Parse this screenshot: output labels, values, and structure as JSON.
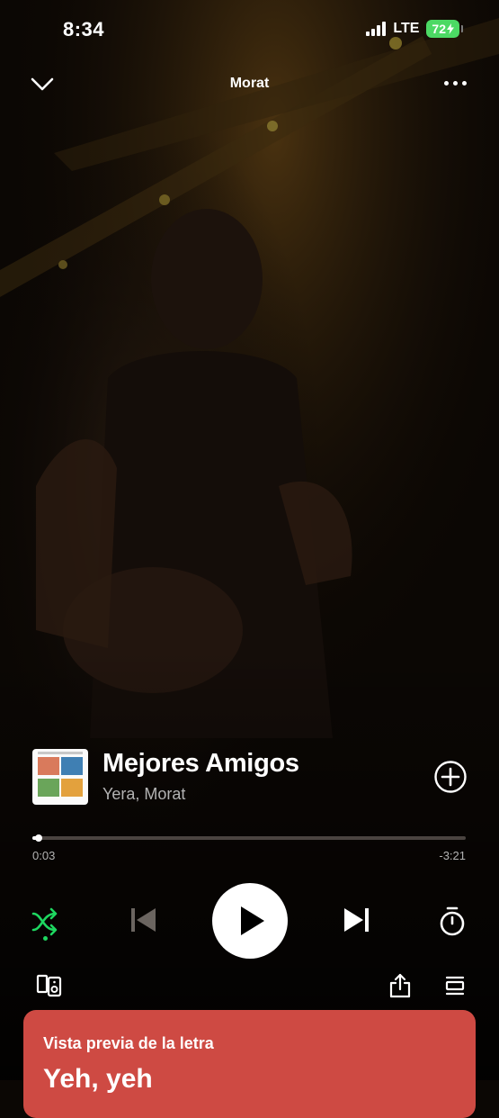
{
  "status_bar": {
    "time": "8:34",
    "network": "LTE",
    "battery": "72"
  },
  "header": {
    "title": "Morat",
    "close_icon": "chevron-down-icon",
    "menu_icon": "more-horizontal-icon"
  },
  "track": {
    "title": "Mejores Amigos",
    "artist": "Yera, Morat",
    "add_icon": "plus-circle-icon"
  },
  "progress": {
    "elapsed": "0:03",
    "remaining": "-3:21",
    "fraction": 0.015
  },
  "controls": {
    "shuffle": "shuffle-icon",
    "shuffle_active": true,
    "previous": "skip-back-icon",
    "play": "play-icon",
    "next": "skip-forward-icon",
    "sleep_timer": "timer-icon"
  },
  "footer": {
    "devices": "connect-device-icon",
    "share": "share-icon",
    "queue": "queue-icon"
  },
  "lyrics": {
    "label": "Vista previa de la letra",
    "first_line": "Yeh, yeh"
  },
  "colors": {
    "accent_green": "#1ed760",
    "lyrics_card": "#ce4a43",
    "background": "#0b0704",
    "battery_green": "#4cd964"
  }
}
